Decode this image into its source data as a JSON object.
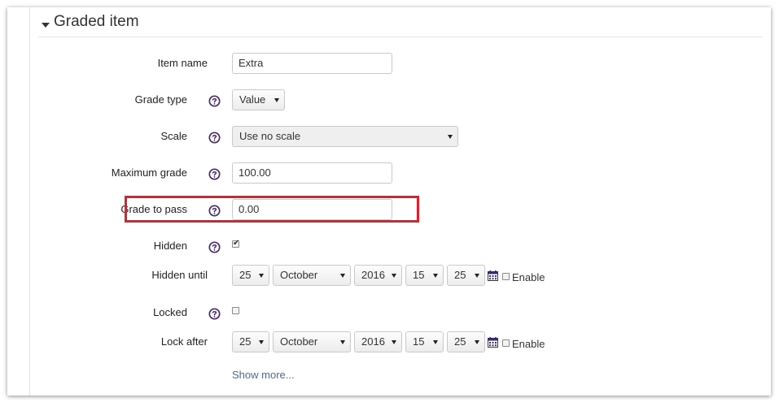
{
  "section": {
    "title": "Graded item"
  },
  "fields": {
    "item_name": {
      "label": "Item name",
      "value": "Extra"
    },
    "grade_type": {
      "label": "Grade type",
      "value": "Value"
    },
    "scale": {
      "label": "Scale",
      "value": "Use no scale"
    },
    "maximum_grade": {
      "label": "Maximum grade",
      "value": "100.00"
    },
    "grade_to_pass": {
      "label": "Grade to pass",
      "value": "0.00"
    },
    "hidden": {
      "label": "Hidden",
      "checked": true
    },
    "hidden_until": {
      "label": "Hidden until",
      "day": "25",
      "month": "October",
      "year": "2016",
      "hour": "15",
      "minute": "25",
      "enable_label": "Enable"
    },
    "locked": {
      "label": "Locked",
      "checked": false
    },
    "lock_after": {
      "label": "Lock after",
      "day": "25",
      "month": "October",
      "year": "2016",
      "hour": "15",
      "minute": "25",
      "enable_label": "Enable"
    }
  },
  "show_more": "Show more...",
  "icons": {
    "help": "help-icon",
    "calendar": "calendar-icon",
    "collapse": "caret-down-icon"
  },
  "colors": {
    "help_icon": "#4a2a6e",
    "highlight": "#e11f2a",
    "link": "#4e6a94"
  }
}
